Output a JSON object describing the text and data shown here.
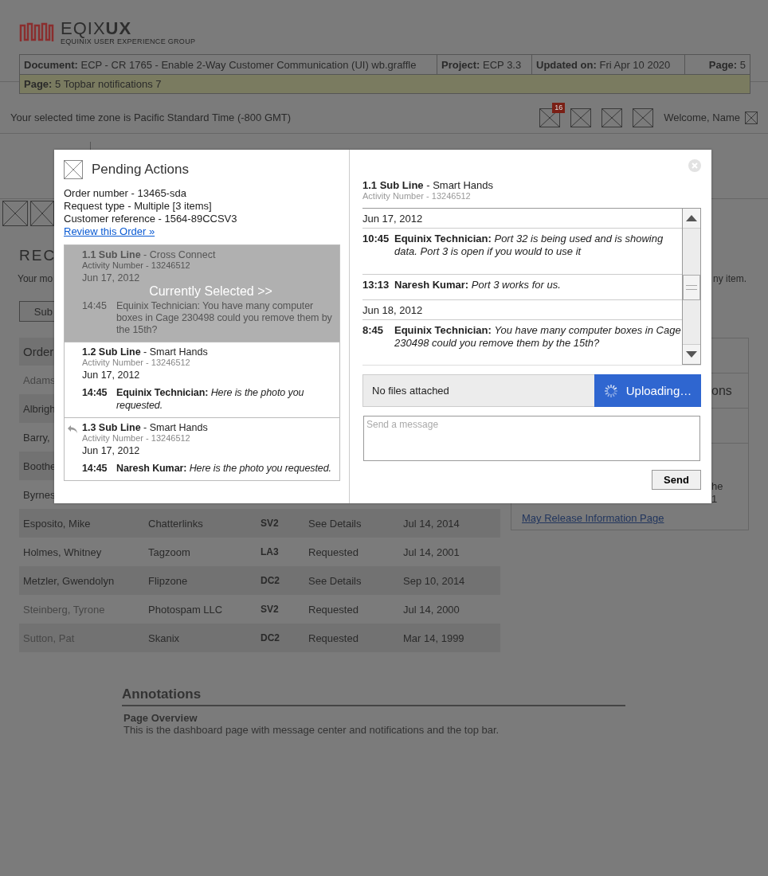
{
  "header": {
    "logo_text": "EQIX**UX**",
    "logo_subtitle": "EQUINIX USER EXPERIENCE GROUP"
  },
  "doc_info": {
    "cells": [
      "**Document:** ECP - CR 1765 - Enable 2-Way Customer Communication (UI) wb.graffle",
      "**Project:** ECP 3.3",
      "**Updated on:** Fri Apr 10 2020",
      "**Page:** 5"
    ],
    "page_line": "**Page:** 5 Topbar notifications 7"
  },
  "topbar": {
    "timezone": "Your selected time zone is Pacific Standard Time (-800 GMT)",
    "notification_badge": "16",
    "welcome": "Welcome, Name"
  },
  "content": {
    "heading": "REC",
    "intro": "Your mo",
    "right_note": "ny item.",
    "button": "Sub"
  },
  "table": {
    "header": "Order",
    "rows": [
      {
        "name": "Adams",
        "muted": true
      },
      {
        "name": "Albrigh",
        "muted": false
      },
      {
        "name": "Barry,",
        "muted": false
      },
      {
        "name": "Boothe",
        "muted": false
      },
      {
        "name": "Byrnes",
        "muted": false
      },
      {
        "name": "Esposito, Mike",
        "company": "Chatterlinks",
        "site": "SV2",
        "status": "See Details",
        "date": "Jul 14, 2014",
        "muted": false
      },
      {
        "name": "Holmes, Whitney",
        "company": "Tagzoom",
        "site": "LA3",
        "status": "Requested",
        "date": "Jul 14, 2001",
        "muted": false
      },
      {
        "name": "Metzler, Gwendolyn",
        "company": "Flipzone",
        "site": "DC2",
        "status": "See Details",
        "date": "Sep 10, 2014",
        "muted": false
      },
      {
        "name": "Steinberg, Tyrone",
        "company": "Photospam LLC",
        "site": "SV2",
        "status": "Requested",
        "date": "Jul 14, 2000",
        "muted": true
      },
      {
        "name": "Sutton, Pat",
        "company": "Skanix",
        "site": "DC2",
        "status": "Requested",
        "date": "Mar 14, 1999",
        "muted": true
      }
    ]
  },
  "side_panel": {
    "row_2": "ons",
    "note_1": "he",
    "note_2": "1",
    "link": "May Release Information Page"
  },
  "annotations": {
    "title": "Annotations",
    "items": [
      {
        "heading": "Page Overview",
        "text": "This is the dashboard page with message center and notifications and the top bar."
      }
    ]
  },
  "modal": {
    "title": "Pending Actions",
    "info": [
      "Order number - 13465-sda",
      "Request type - Multiple [3 items]",
      "Customer reference - 1564-89CCSV3"
    ],
    "review_link": "Review this Order »",
    "selected_label": "Currently Selected  >>",
    "items": [
      {
        "header": "**1.1 Sub Line** - Cross Connect",
        "activity": "Activity Number - 13246512",
        "date": "Jun 17, 2012",
        "time": "14:45",
        "message": "Equinix Technician: You have many computer boxes in Cage 230498 could you remove them by the 15th?",
        "selected": true,
        "replied": false
      },
      {
        "header": "**1.2 Sub Line**  - Smart Hands",
        "activity": "Activity Number - 13246512",
        "date": "Jun 17, 2012",
        "time": "14:45",
        "message": "**Equinix Technician:** *Here is the photo you requested.*",
        "selected": false,
        "replied": false
      },
      {
        "header": "**1.3 Sub Line**  - Smart Hands",
        "activity": "Activity Number - 13246512",
        "date": "Jun 17, 2012",
        "time": "14:45",
        "message": "**Naresh Kumar:** *Here is the photo you requested.*",
        "selected": false,
        "replied": true
      }
    ],
    "detail": {
      "header": "**1.1 Sub Line**  - Smart Hands",
      "activity": "Activity Number - 13246512",
      "thread": [
        {
          "kind": "date",
          "text": "Jun 17, 2012"
        },
        {
          "kind": "message",
          "time": "10:45",
          "text": "**Equinix Technician:** *Port 32 is being used and is showing data. Port 3 is open if you would to use it*"
        },
        {
          "kind": "message",
          "time": "13:13",
          "text": "**Naresh Kumar:** *Port 3 works for us.*"
        },
        {
          "kind": "date",
          "text": "Jun 18, 2012"
        },
        {
          "kind": "message",
          "time": "8:45",
          "text": "**Equinix Technician:** *You have many computer boxes in Cage 230498 could you remove them by the 15th?*"
        }
      ],
      "attachment_status": "No files attached",
      "upload_button": "Uploading…",
      "message_placeholder": "Send a message",
      "send_button": "Send"
    }
  }
}
